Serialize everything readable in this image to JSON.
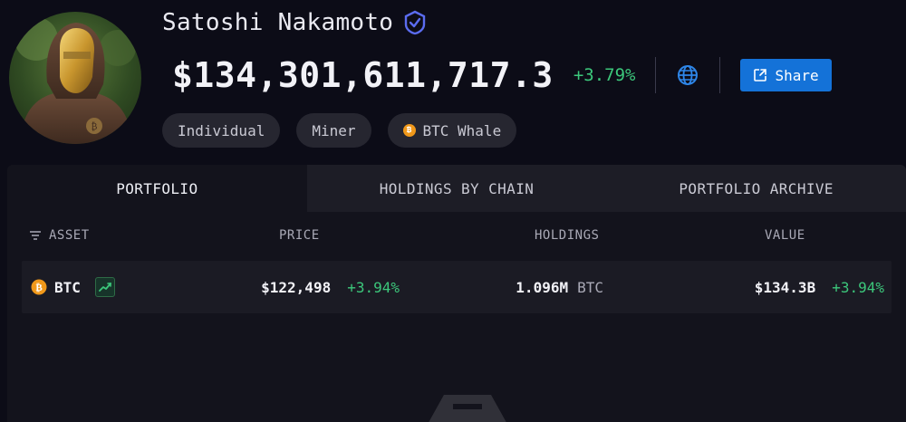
{
  "profile": {
    "name": "Satoshi Nakamoto",
    "net_worth": "$134,301,611,717.3",
    "change": "+3.79%",
    "share_label": "Share",
    "tags": [
      {
        "label": "Individual"
      },
      {
        "label": "Miner"
      },
      {
        "label": "BTC Whale",
        "icon": "btc-coin-icon"
      }
    ]
  },
  "tabs": [
    "PORTFOLIO",
    "HOLDINGS BY CHAIN",
    "PORTFOLIO ARCHIVE"
  ],
  "table": {
    "headers": {
      "asset": "ASSET",
      "price": "PRICE",
      "holdings": "HOLDINGS",
      "value": "VALUE"
    },
    "rows": [
      {
        "asset": "BTC",
        "price": "$122,498",
        "price_change": "+3.94%",
        "holdings": "1.096M",
        "holdings_unit": "BTC",
        "value": "$134.3B",
        "value_change": "+3.94%"
      }
    ]
  },
  "colors": {
    "positive": "#3cc77b",
    "accent": "#1472d8",
    "btc": "#f0981a"
  },
  "icons": [
    "verified-badge-icon",
    "globe-icon",
    "share-icon",
    "btc-coin-icon",
    "sort-icon",
    "trend-chart-icon"
  ]
}
